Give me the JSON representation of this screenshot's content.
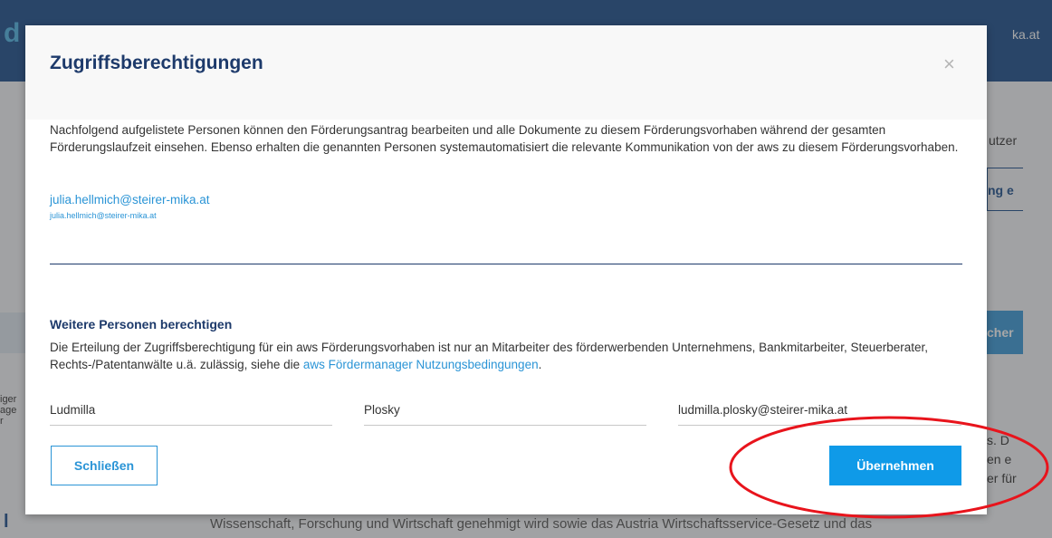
{
  "background": {
    "logo": "d",
    "user_fragment": "ka.at",
    "right_nutz": "utzer",
    "right_button": "ng e",
    "right_blue_button": "cher",
    "right_text": [
      "s. D",
      "en e",
      "er für"
    ],
    "left_side_text": [
      "iger",
      "age",
      "r"
    ],
    "left_letter": "l",
    "bottom_text": "Wissenschaft, Forschung und Wirtschaft genehmigt wird sowie das Austria Wirtschaftsservice-Gesetz und das"
  },
  "modal": {
    "title": "Zugriffsberechtigungen",
    "close_glyph": "×",
    "intro": "Nachfolgend aufgelistete Personen können den Förderungsantrag bearbeiten und alle Dokumente zu diesem Förderungsvorhaben während der gesamten Förderungslaufzeit einsehen. Ebenso erhalten die genannten Personen systemautomatisiert die relevante Kommunikation von der aws zu diesem Förderungsvorhaben.",
    "authorized_person": {
      "email": "julia.hellmich@steirer-mika.at",
      "email_sub": "julia.hellmich@steirer-mika.at"
    },
    "section_title": "Weitere Personen berechtigen",
    "section_text": "Die Erteilung der Zugriffsberechtigung für ein aws Förderungsvorhaben ist nur an Mitarbeiter des förderwerbenden Unternehmens, Bankmitarbeiter, Steuerberater, Rechts-/Patentanwälte u.ä. zulässig, siehe die ",
    "section_link": "aws Fördermanager Nutzungsbedingungen",
    "section_text_end": ".",
    "fields": {
      "first_name": "Ludmilla",
      "last_name": "Plosky",
      "email": "ludmilla.plosky@steirer-mika.at"
    },
    "close_label": "Schließen",
    "apply_label": "Übernehmen"
  },
  "colors": {
    "accent": "#0f9ae8",
    "title": "#1d3a6b",
    "highlight": "#e8141c"
  }
}
